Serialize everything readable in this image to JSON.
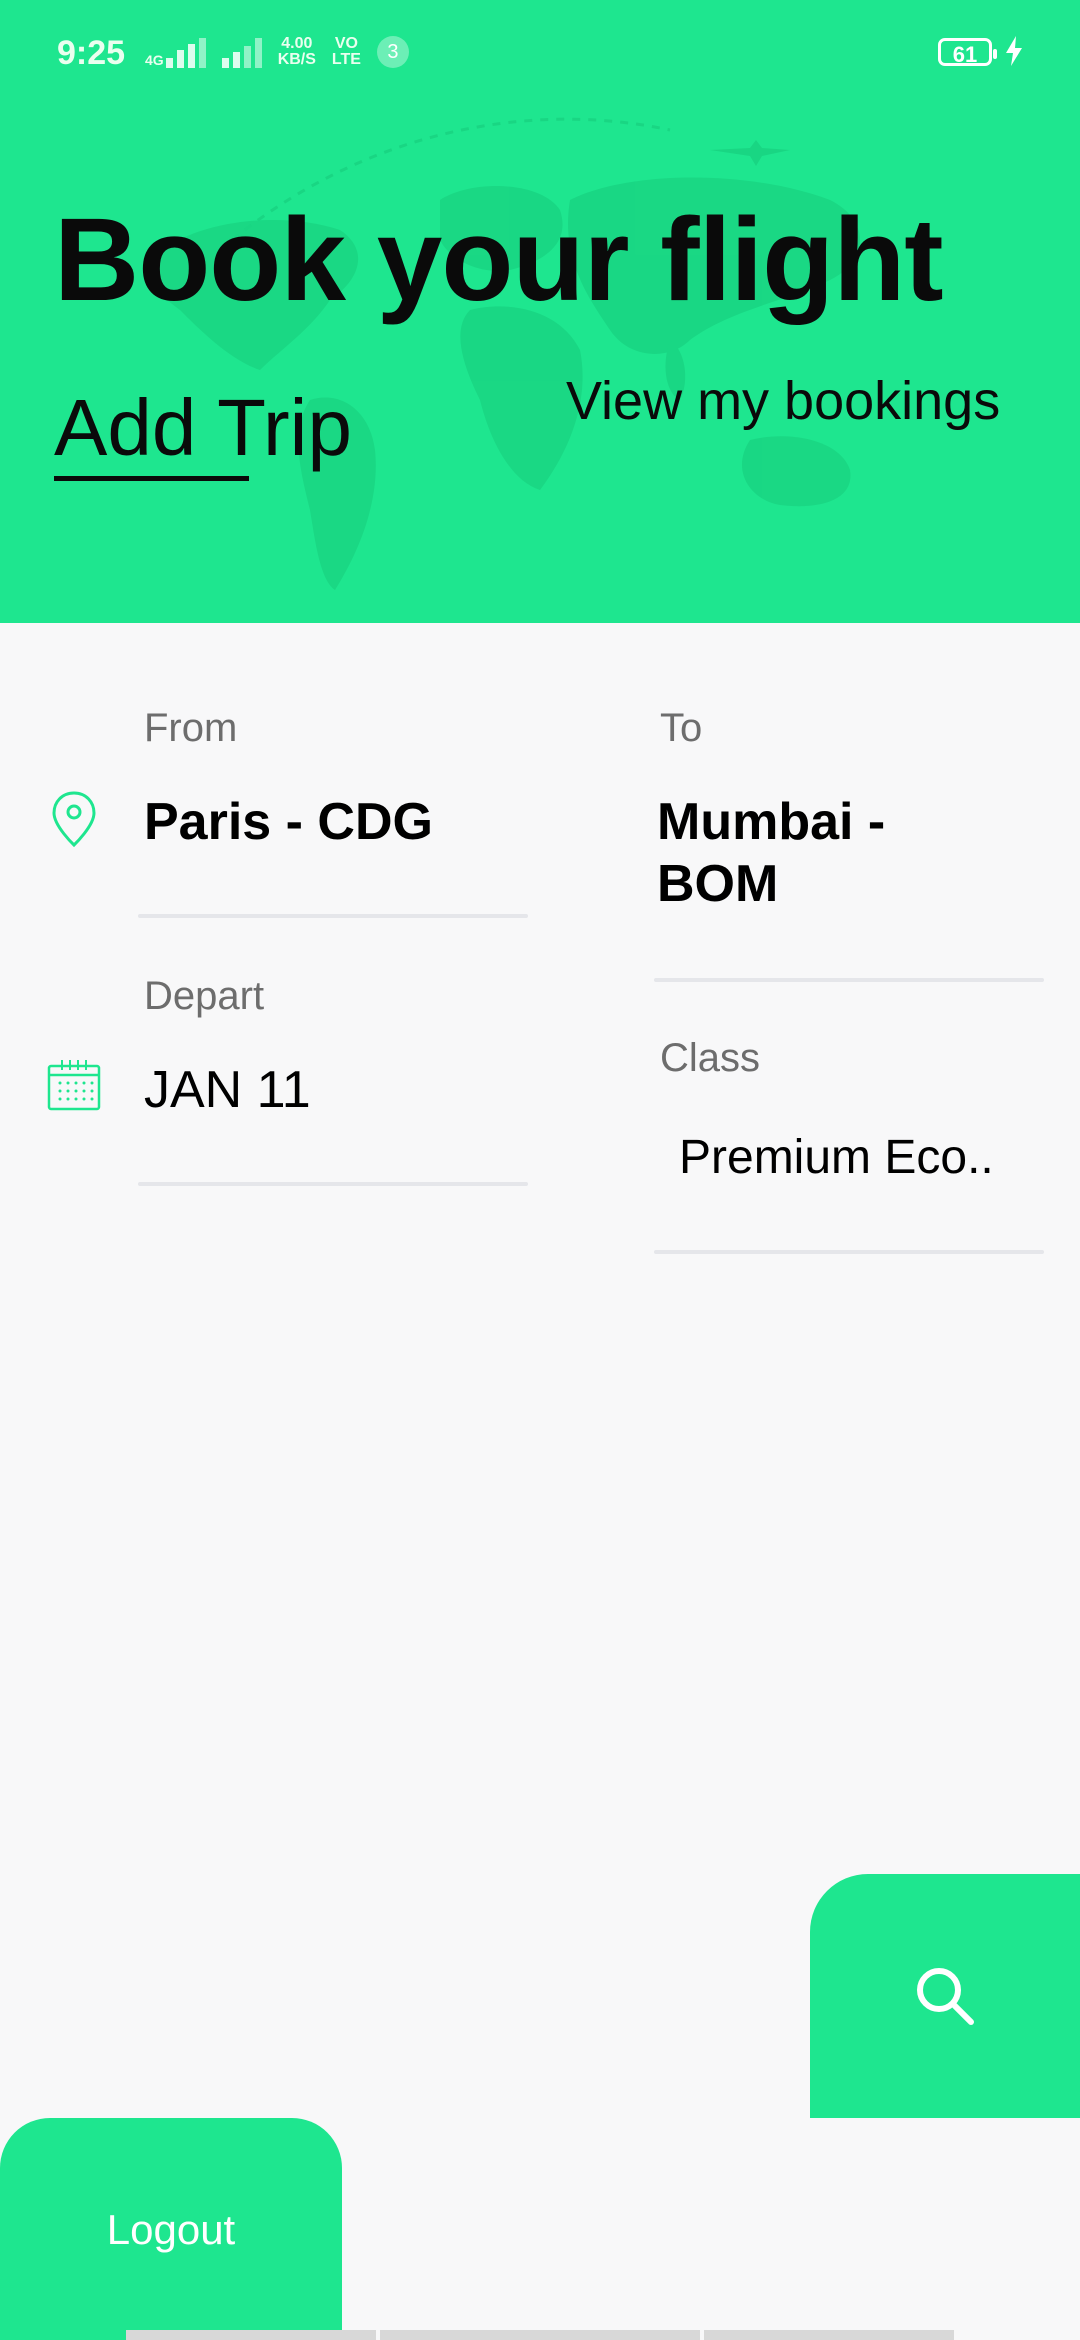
{
  "status_bar": {
    "time": "9:25",
    "network": "4G",
    "speed_value": "4.00",
    "speed_unit": "KB/S",
    "volte_top": "VO",
    "volte_bottom": "LTE",
    "notification_count": "3",
    "battery": "61"
  },
  "header": {
    "title": "Book your flight",
    "tabs": [
      {
        "label": "Add Trip",
        "active": true
      },
      {
        "label": "View my bookings",
        "active": false
      }
    ]
  },
  "form": {
    "from": {
      "label": "From",
      "value": "Paris - CDG"
    },
    "to": {
      "label": "To",
      "value_line1": "Mumbai -",
      "value_line2": "BOM"
    },
    "depart": {
      "label": "Depart",
      "value": "JAN 11"
    },
    "class": {
      "label": "Class",
      "value": "Premium Eco.."
    }
  },
  "actions": {
    "search_icon": "search-icon",
    "logout_label": "Logout"
  },
  "colors": {
    "accent": "#1ee68f",
    "background": "#f8f8f9",
    "divider": "#e5e6ea"
  }
}
